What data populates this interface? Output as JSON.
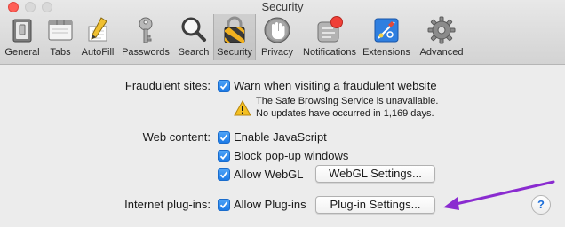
{
  "window": {
    "title": "Security"
  },
  "toolbar": {
    "items": [
      {
        "label": "General",
        "icon": "general-switch-icon"
      },
      {
        "label": "Tabs",
        "icon": "tabs-window-icon"
      },
      {
        "label": "AutoFill",
        "icon": "autofill-pencil-icon"
      },
      {
        "label": "Passwords",
        "icon": "key-icon"
      },
      {
        "label": "Search",
        "icon": "magnifier-icon"
      },
      {
        "label": "Security",
        "icon": "padlock-icon",
        "selected": true
      },
      {
        "label": "Privacy",
        "icon": "hand-icon"
      },
      {
        "label": "Notifications",
        "icon": "notifications-badge-icon"
      },
      {
        "label": "Extensions",
        "icon": "puzzle-icon"
      },
      {
        "label": "Advanced",
        "icon": "gear-icon"
      }
    ]
  },
  "fraudulent": {
    "label": "Fraudulent sites:",
    "warn_checkbox": {
      "label": "Warn when visiting a fraudulent website",
      "checked": true
    },
    "warning_icon": "warning-triangle-icon",
    "warning_line1": "The Safe Browsing Service is unavailable.",
    "warning_line2": "No updates have occurred in 1,169 days."
  },
  "web_content": {
    "label": "Web content:",
    "enable_js": {
      "label": "Enable JavaScript",
      "checked": true
    },
    "block_popups": {
      "label": "Block pop-up windows",
      "checked": true
    },
    "allow_webgl": {
      "label": "Allow WebGL",
      "checked": true
    },
    "webgl_settings_button": "WebGL Settings..."
  },
  "plugins": {
    "label": "Internet plug-ins:",
    "allow_plugins": {
      "label": "Allow Plug-ins",
      "checked": true
    },
    "plugin_settings_button": "Plug-in Settings..."
  },
  "help": {
    "label": "?"
  },
  "annotation": {
    "arrow_color": "#8a2bd0"
  },
  "colors": {
    "checkbox_blue": "#1c7ae6",
    "help_blue": "#1f6fd9"
  }
}
